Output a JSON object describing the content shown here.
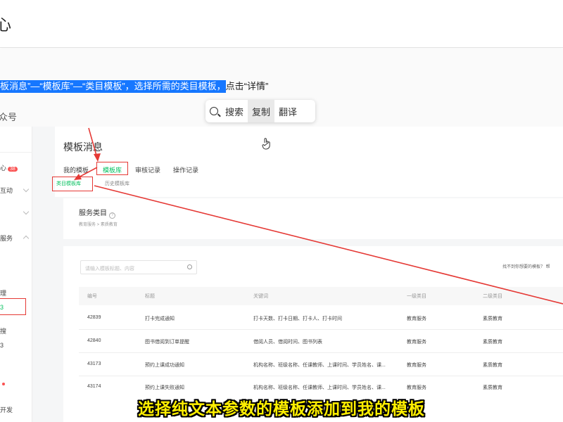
{
  "topbar": {
    "title_fragment": "心"
  },
  "instruction": {
    "highlighted": "板消息”—“模板库”—“类目模板”，选择所需的类目模板，",
    "rest": "点击“详情”"
  },
  "account_label": "众号",
  "selection_toolbar": {
    "search": "搜索",
    "copy": "复制",
    "translate": "翻译"
  },
  "sidebar": {
    "items": [
      {
        "label": "心",
        "badge": "38"
      },
      {
        "label": "互动"
      },
      {
        "label": ""
      },
      {
        "label": "服务"
      },
      {
        "label": "理"
      },
      {
        "label": "3"
      },
      {
        "label": "搜"
      },
      {
        "label": "3"
      },
      {
        "label": ""
      },
      {
        "label": "开发"
      }
    ]
  },
  "page": {
    "title": "模板消息",
    "tabs": [
      "我的模板",
      "模板库",
      "审核记录",
      "操作记录"
    ],
    "subtabs": [
      "类目模板库",
      "历史模板库"
    ]
  },
  "service": {
    "title": "服务类目",
    "crumb": "教育服务 > 素质教育"
  },
  "list": {
    "search_placeholder": "请输入模板标题、内容",
    "not_found": "找不到你想要的模板？ 帮",
    "columns": [
      "编号",
      "标题",
      "关键词",
      "一级类目",
      "二级类目"
    ],
    "rows": [
      [
        "42839",
        "打卡完成通知",
        "打卡天数、打卡日期、打卡人、打卡时间",
        "教育服务",
        "素质教育"
      ],
      [
        "42840",
        "图书借阅到订单提醒",
        "借阅人员、借阅时间、图书列表",
        "教育服务",
        "素质教育"
      ],
      [
        "43173",
        "预约上课成功通知",
        "机构名称、班级名称、任课教师、上课时间、学员姓名、课...",
        "教育服务",
        "素质教育"
      ],
      [
        "43174",
        "预约上课失败通知",
        "机构名称、班级名称、任课教师、上课时间、学员姓名、课...",
        "教育服务",
        "素质教育"
      ]
    ]
  },
  "subtitle": "选择纯文本参数的模板添加到我的模板",
  "colors": {
    "highlight": "#1677ff",
    "accent_green": "#07c160",
    "annotation_red": "#e53935",
    "subtitle_yellow": "#ffef00"
  }
}
